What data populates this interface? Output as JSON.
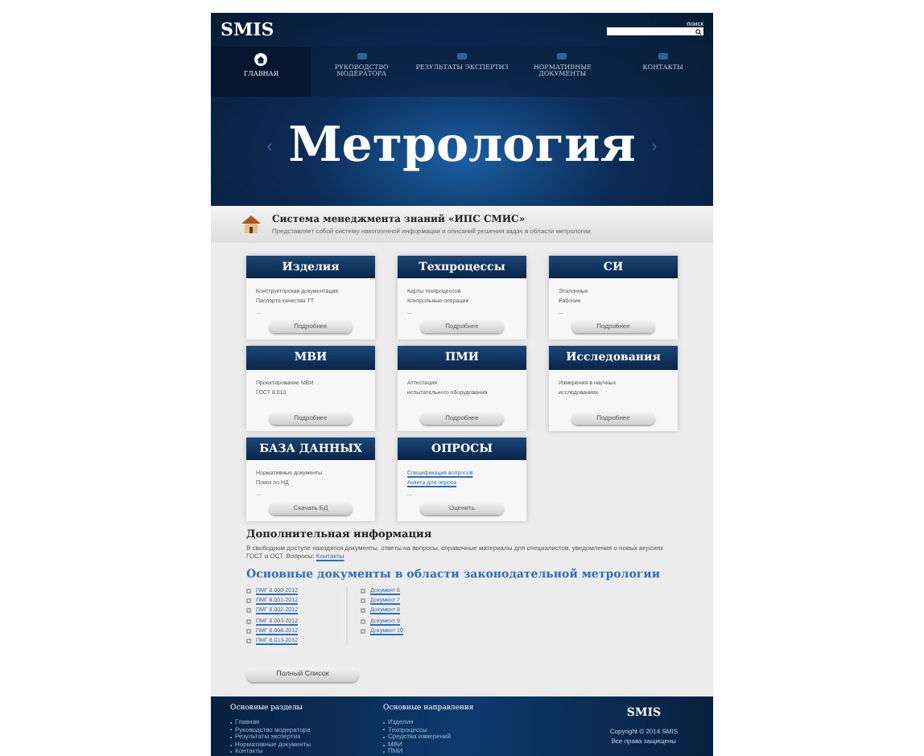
{
  "header": {
    "logo": "SMIS",
    "search_label": "поиск"
  },
  "nav": [
    {
      "label": "ГЛАВНАЯ",
      "selected": true
    },
    {
      "label": "РУКОВОДСТВО МОДЕРАТОРА",
      "selected": false
    },
    {
      "label": "РЕЗУЛЬТАТЫ ЭКСПЕРТИЗ",
      "selected": false
    },
    {
      "label": "НОРМАТИВНЫЕ ДОКУМЕНТЫ",
      "selected": false
    },
    {
      "label": "КОНТАКТЫ",
      "selected": false
    }
  ],
  "hero": {
    "title": "Метрология",
    "prev": "‹",
    "next": "›"
  },
  "intro": {
    "title": "Система менеджмента знаний **«ИПС СМИС»**",
    "text": "Представляет собой систему накопленной информации и описаний решения задач в области метрологии."
  },
  "cards": [
    {
      "title": "Изделия",
      "lines": [
        {
          "kind": "text",
          "text": "Конструкторская документация"
        },
        {
          "kind": "text",
          "text": "Паспорта качества ТТ"
        },
        {
          "kind": "text",
          "text": "..."
        }
      ],
      "button": "Подробнее"
    },
    {
      "title": "Техпроцессы",
      "lines": [
        {
          "kind": "text",
          "text": "Карты техпроцессов"
        },
        {
          "kind": "text",
          "text": "Контрольные операции"
        },
        {
          "kind": "text",
          "text": "..."
        }
      ],
      "button": "Подробнее"
    },
    {
      "title": "СИ",
      "lines": [
        {
          "kind": "text",
          "text": "Эталонные"
        },
        {
          "kind": "text",
          "text": "Рабочие"
        },
        {
          "kind": "text",
          "text": "..."
        }
      ],
      "button": "Подробнее"
    },
    {
      "title": "МВИ",
      "lines": [
        {
          "kind": "text",
          "text": "Проектирование МВИ"
        },
        {
          "kind": "text",
          "text": "ГОСТ 8.010"
        }
      ],
      "button": "Подробнее"
    },
    {
      "title": "ПМИ",
      "lines": [
        {
          "kind": "text",
          "text": "Аттестация"
        },
        {
          "kind": "text",
          "text": "испытательного оборудования"
        }
      ],
      "button": "Подробнее"
    },
    {
      "title": "Исследования",
      "lines": [
        {
          "kind": "text",
          "text": "Измерения в научных"
        },
        {
          "kind": "text",
          "text": "исследованиях"
        }
      ],
      "button": "Подробнее"
    },
    {
      "title": "БАЗА ДАННЫХ",
      "lines": [
        {
          "kind": "text",
          "text": "Нормативные документы"
        },
        {
          "kind": "text",
          "text": "Поиск по НД"
        },
        {
          "kind": "text",
          "text": "..."
        }
      ],
      "button": "Скачать БД"
    },
    {
      "title": "ОПРОСЫ",
      "lines": [
        {
          "kind": "link",
          "text": "Спецификация вопросов"
        },
        {
          "kind": "link",
          "text": "Анкета для опроса"
        },
        {
          "kind": "text",
          "text": "..."
        }
      ],
      "button": "Оценить"
    }
  ],
  "additional": {
    "title": "Дополнительная информация",
    "text": "В свободном доступе находятся документы, ответы на вопросы, справочные материалы для специалистов, уведомления о новых версиях ГОСТ и ОСТ. Вопросы:",
    "link": "Контакты"
  },
  "documents": {
    "title": "Основные документы в области законодательной метрологии",
    "left": [
      {
        "label": "ПМГ 8.000-2012",
        "checked": false
      },
      {
        "label": "ПМГ 8.001-2012",
        "checked": false
      },
      {
        "label": "ПМГ 8.002-2012",
        "checked": false
      },
      {
        "label": "ПМГ 8.003-2012",
        "checked": false
      },
      {
        "label": "ПМГ 8.008-2012",
        "checked": false
      },
      {
        "label": "ПМГ 8.013-2012",
        "checked": false
      }
    ],
    "right": [
      {
        "label": "Документ 6",
        "checked": false
      },
      {
        "label": "Документ 7",
        "checked": false
      },
      {
        "label": "Документ 8",
        "checked": false
      },
      {
        "label": "Документ 9",
        "checked": false
      },
      {
        "label": "Документ 10",
        "checked": false
      }
    ],
    "button": "Полный Список"
  },
  "footer": {
    "columns": [
      {
        "title": "Основные разделы",
        "items": [
          "Главная",
          "Руководство модератора",
          "Результаты экспертиз",
          "Нормативные документы",
          "Контакты"
        ]
      },
      {
        "title": "Основные направления",
        "items": [
          "Изделия",
          "Техпроцессы",
          "Средства измерений",
          "МВИ",
          "ПМИ"
        ]
      }
    ],
    "logo": "SMIS",
    "copyright": "Copyright © 2014 SMIS",
    "rights": "Все права защищены"
  }
}
